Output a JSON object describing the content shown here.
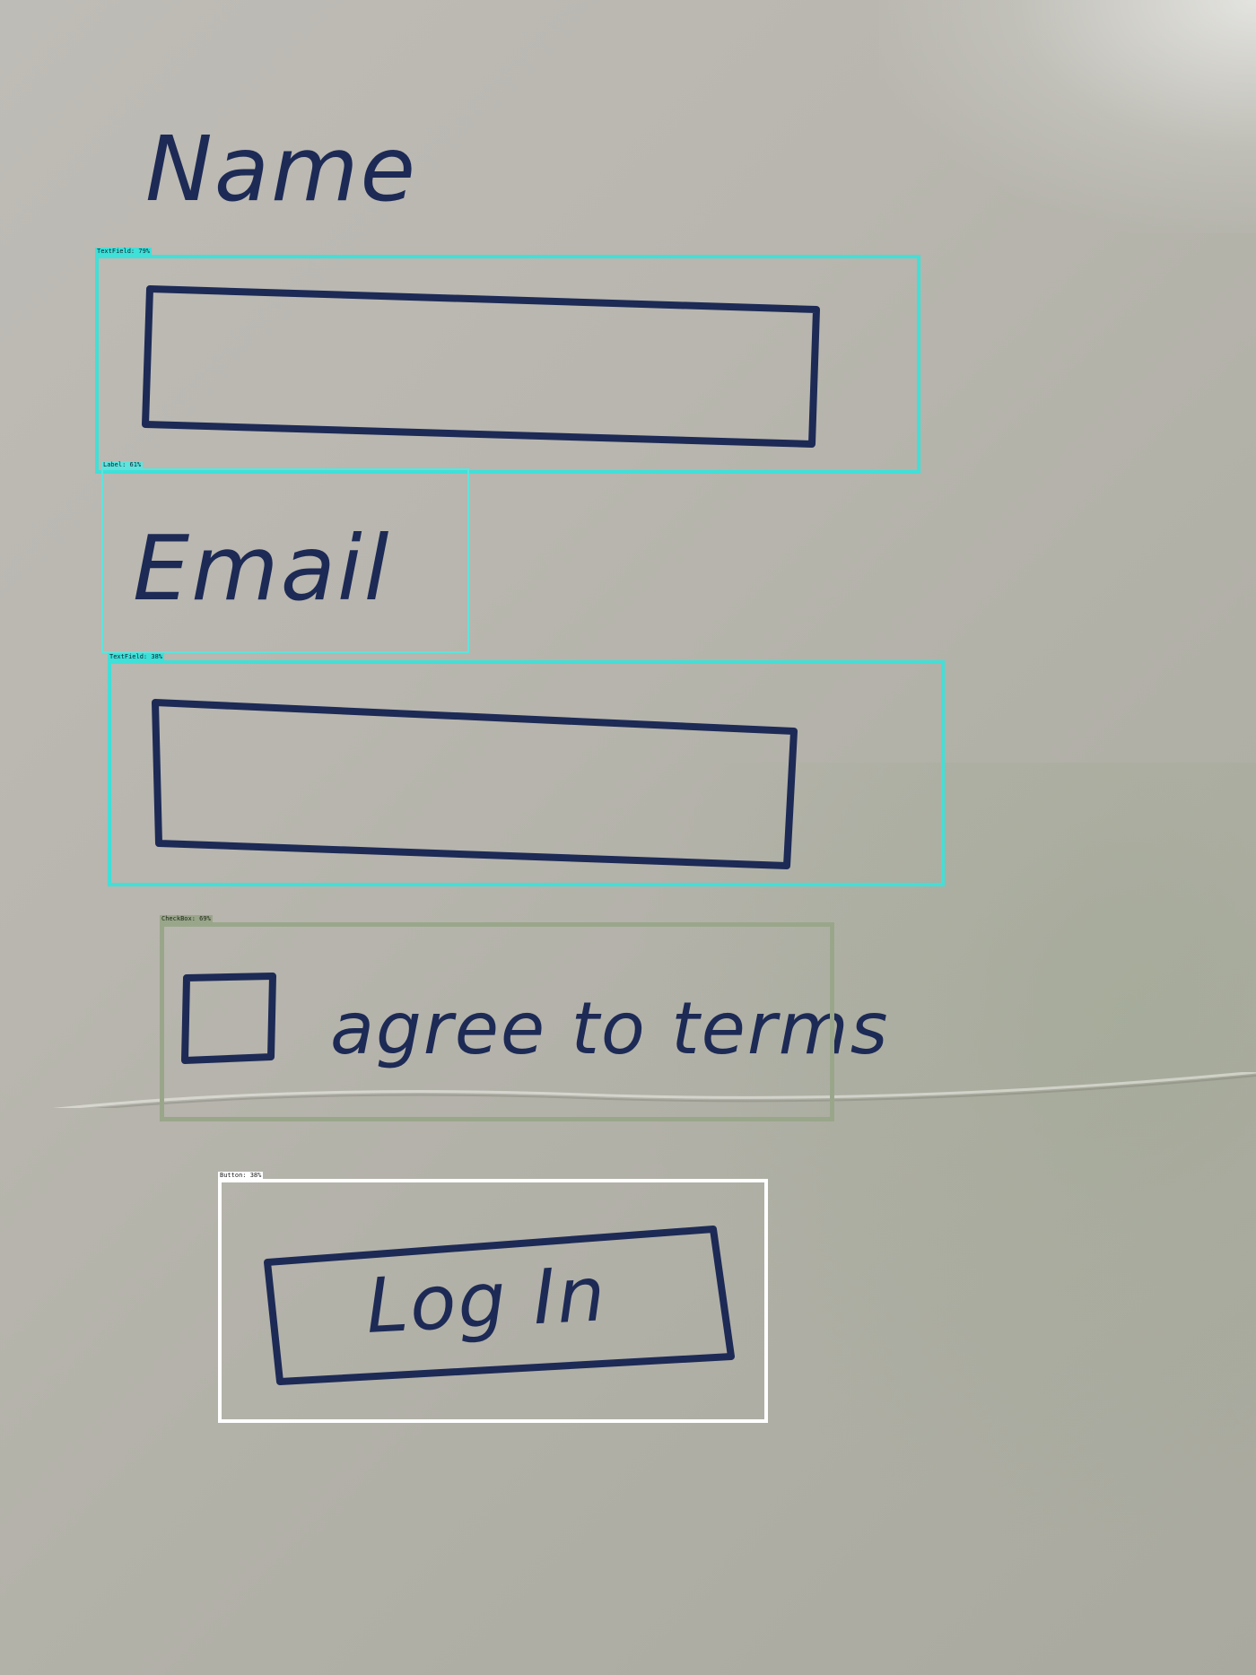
{
  "form": {
    "name_label": "Name",
    "email_label": "Email",
    "terms_label": "agree to terms",
    "login_label": "Log In",
    "name_value": "",
    "email_value": "",
    "terms_checked": false
  },
  "detections": [
    {
      "id": "name_field",
      "label": "TextField: 79%"
    },
    {
      "id": "email_label",
      "label": "Label: 61%"
    },
    {
      "id": "email_field",
      "label": "TextField: 38%"
    },
    {
      "id": "terms_checkbox",
      "label": "CheckBox: 69%"
    },
    {
      "id": "login_button",
      "label": "Button: 38%"
    }
  ],
  "colors": {
    "ink": "#1d2a55",
    "textfield_box": "#3fe0d8",
    "label_box": "#5fe3dc",
    "checkbox_box": "#9aa68a",
    "button_box": "#ffffff",
    "paper": "#b8b6ae"
  }
}
